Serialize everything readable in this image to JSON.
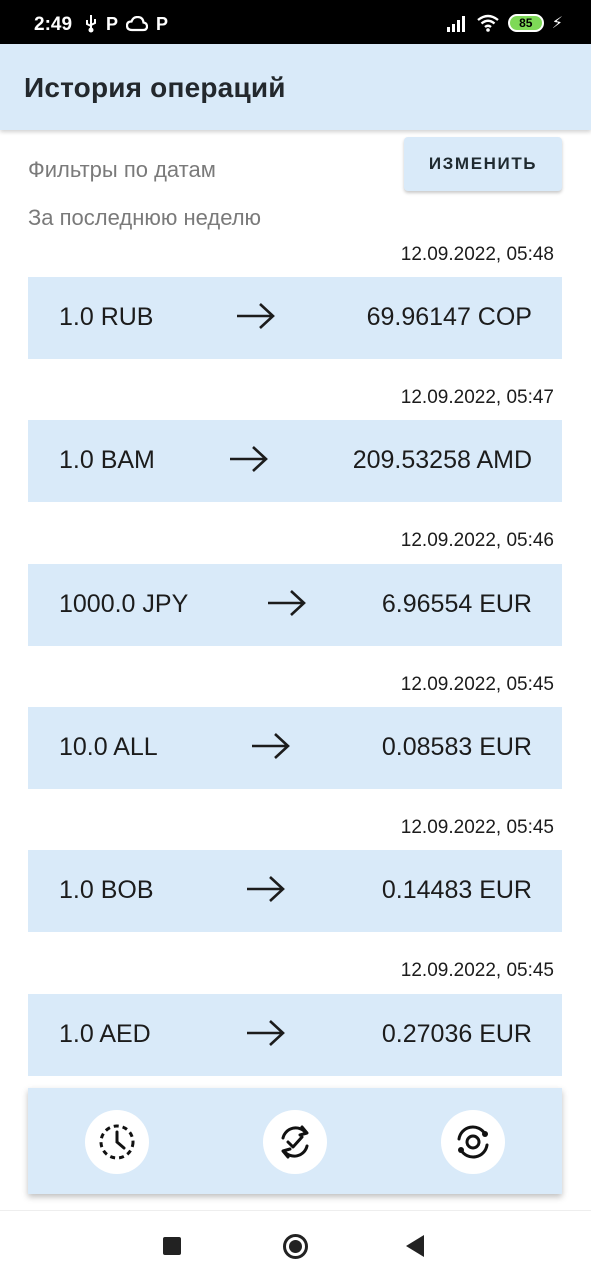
{
  "status": {
    "time": "2:49",
    "left_icons": [
      "usb-icon",
      "parking-p-icon",
      "cloud-icon",
      "parking-p-icon"
    ],
    "battery": "85"
  },
  "header": {
    "title": "История операций"
  },
  "filters": {
    "label": "Фильтры по датам",
    "value": "За последнюю неделю",
    "change_label": "ИЗМЕНИТЬ"
  },
  "operations": [
    {
      "date": "12.09.2022, 05:48",
      "from": "1.0 RUB",
      "to": "69.96147 COP"
    },
    {
      "date": "12.09.2022, 05:47",
      "from": "1.0 BAM",
      "to": "209.53258 AMD"
    },
    {
      "date": "12.09.2022, 05:46",
      "from": "1000.0 JPY",
      "to": "6.96554 EUR"
    },
    {
      "date": "12.09.2022, 05:45",
      "from": "10.0 ALL",
      "to": "0.08583 EUR"
    },
    {
      "date": "12.09.2022, 05:45",
      "from": "1.0 BOB",
      "to": "0.14483 EUR"
    },
    {
      "date": "12.09.2022, 05:45",
      "from": "1.0 AED",
      "to": "0.27036 EUR"
    }
  ],
  "bottom_nav": {
    "items": [
      {
        "icon": "history-clock-icon"
      },
      {
        "icon": "sync-check-icon"
      },
      {
        "icon": "currency-exchange-icon"
      }
    ]
  },
  "colors": {
    "accent": "#d9eaf9",
    "text": "#1c1c1c",
    "muted": "#7a7a7a"
  }
}
